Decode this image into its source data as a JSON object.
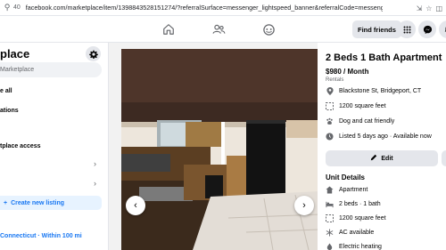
{
  "browser": {
    "zoom": "40",
    "url": "facebook.com/marketplace/item/1398843528151274/?referralSurface=messenger_lightspeed_banner&referralCode=messenger_banner"
  },
  "nav": {
    "find_friends": "Find friends"
  },
  "sidebar": {
    "title": "place",
    "search_placeholder": "Marketplace",
    "item_all": "e all",
    "item_notifications": "ations",
    "item_access": "tplace access",
    "create_listing": "Create new listing",
    "location": "Connecticut · Within 100 mi"
  },
  "listing": {
    "title": "2 Beds 1 Bath Apartment",
    "price": "$980 / Month",
    "category": "Rentals",
    "address": "Blackstone St, Bridgeport, CT",
    "area": "1200 square feet",
    "pets": "Dog and cat friendly",
    "listed": "Listed 5 days ago · Available now",
    "edit_label": "Edit",
    "unit_details_heading": "Unit Details",
    "unit_details": [
      "Apartment",
      "2 beds · 1 bath",
      "1200 square feet",
      "AC available",
      "Electric heating"
    ]
  },
  "colors": {
    "accent": "#1877f2",
    "button_gray": "#e4e6eb",
    "secondary_text": "#65676b"
  }
}
